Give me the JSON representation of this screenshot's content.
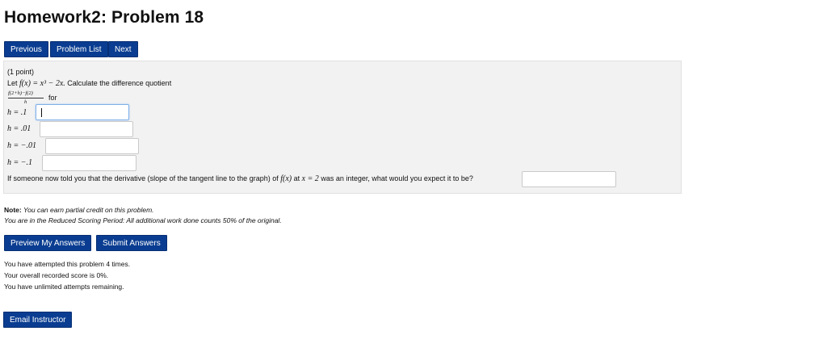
{
  "page": {
    "title": "Homework2: Problem 18"
  },
  "nav": {
    "previous": "Previous",
    "problem_list": "Problem List",
    "next": "Next"
  },
  "problem": {
    "points": "(1 point)",
    "intro_prefix": "Let ",
    "function_expr": "f(x) = x³ − 2x.",
    "intro_suffix": " Calculate the difference quotient",
    "quotient_numerator": "f(2+h)−f(2)",
    "quotient_denominator": "h",
    "for_label": "for",
    "h_values": [
      {
        "label": "h = .1",
        "value": ""
      },
      {
        "label": "h = .01",
        "value": ""
      },
      {
        "label": "h = −.01",
        "value": ""
      },
      {
        "label": "h = −.1",
        "value": ""
      }
    ],
    "derivative_question_a": "If someone now told you that the derivative (slope of the tangent line to the graph) of ",
    "derivative_fx": "f(x)",
    "derivative_question_b": " at ",
    "derivative_at": "x = 2",
    "derivative_question_c": " was an integer, what would you expect it to be?",
    "derivative_answer": ""
  },
  "notes": {
    "note_label": "Note:",
    "note_text": " You can earn partial credit on this problem.",
    "reduced_scoring": "You are in the Reduced Scoring Period: All additional work done counts 50% of the original."
  },
  "actions": {
    "preview": "Preview My Answers",
    "submit": "Submit Answers"
  },
  "status": {
    "attempts": "You have attempted this problem 4 times.",
    "score": "Your overall recorded score is 0%.",
    "remaining": "You have unlimited attempts remaining."
  },
  "footer": {
    "email_instructor": "Email Instructor"
  }
}
